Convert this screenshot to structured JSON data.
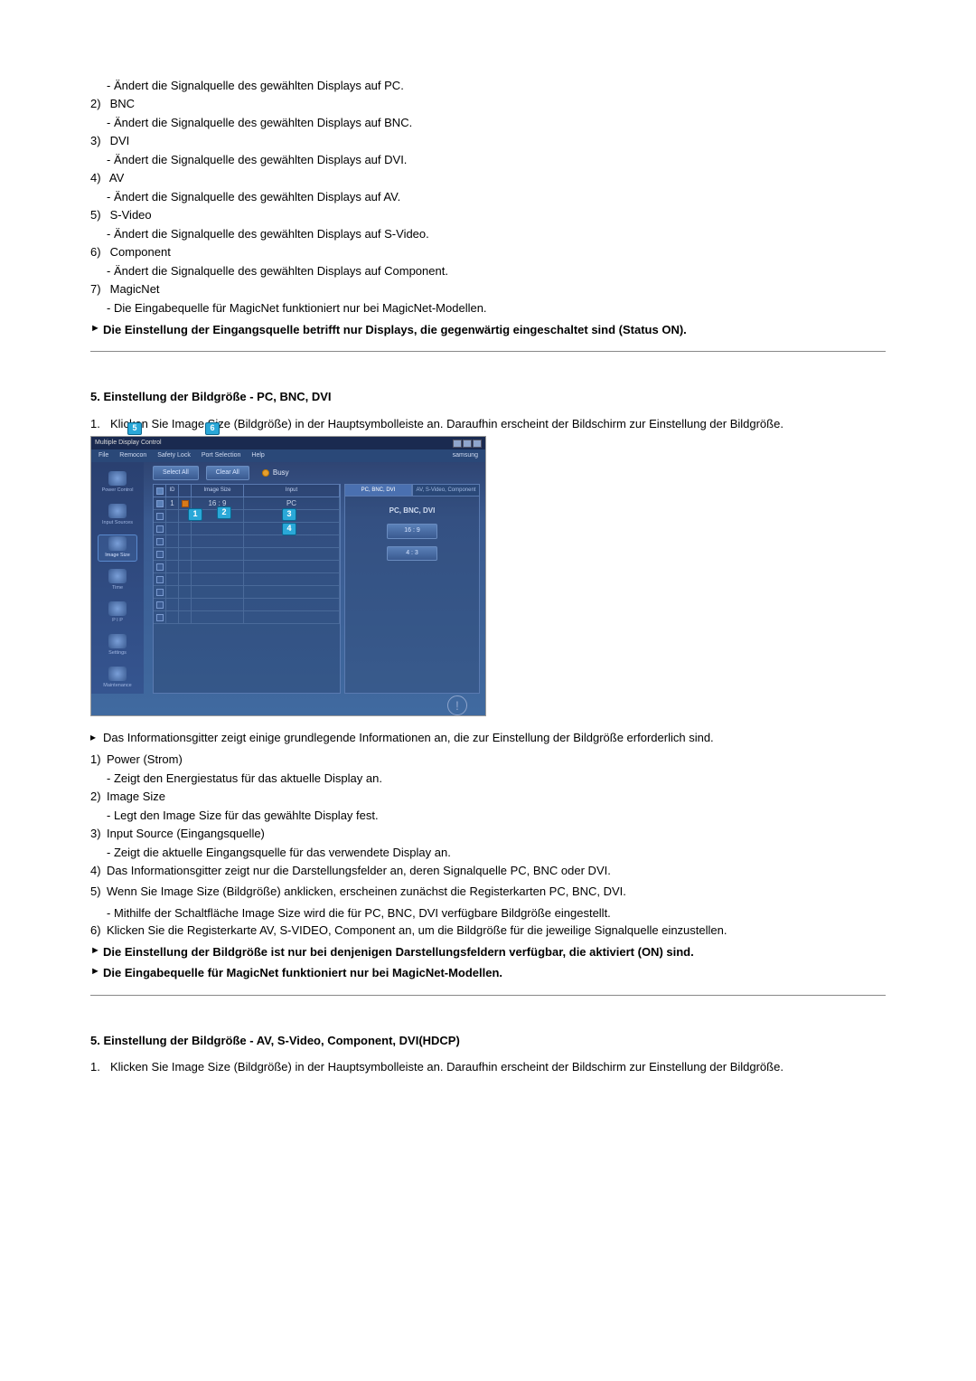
{
  "top_list": [
    {
      "sub": "- Ändert die Signalquelle des gewählten Displays auf PC."
    },
    {
      "num": "2)",
      "label": "BNC",
      "sub": "- Ändert die Signalquelle des gewählten Displays auf BNC."
    },
    {
      "num": "3)",
      "label": "DVI",
      "sub": "- Ändert die Signalquelle des gewählten Displays auf DVI."
    },
    {
      "num": "4)",
      "label": "AV",
      "sub": "- Ändert die Signalquelle des gewählten Displays auf AV."
    },
    {
      "num": "5)",
      "label": "S-Video",
      "sub": "- Ändert die Signalquelle des gewählten Displays auf S-Video."
    },
    {
      "num": "6)",
      "label": "Component",
      "sub": "- Ändert die Signalquelle des gewählten Displays auf Component."
    },
    {
      "num": "7)",
      "label": "MagicNet",
      "sub": "- Die Eingabequelle für MagicNet funktioniert nur bei MagicNet-Modellen."
    }
  ],
  "top_note": "Die Einstellung der Eingangsquelle betrifft nur Displays, die gegenwärtig eingeschaltet sind (Status ON).",
  "section5": {
    "title": "5. Einstellung der Bildgröße - PC, BNC, DVI",
    "intro_num": "1.",
    "intro": "Klicken Sie Image Size (Bildgröße) in der Hauptsymbolleiste an. Daraufhin erscheint der Bildschirm zur Einstellung der Bildgröße.",
    "info_note": "Das Informationsgitter zeigt einige grundlegende Informationen an, die zur Einstellung der Bildgröße erforderlich sind.",
    "items": [
      {
        "num": "1)",
        "label": "Power (Strom)",
        "sub": "- Zeigt den Energiestatus für das aktuelle Display an."
      },
      {
        "num": "2)",
        "label": "Image Size",
        "sub": "- Legt den Image Size für das gewählte Display fest."
      },
      {
        "num": "3)",
        "label": "Input Source (Eingangsquelle)",
        "sub": "- Zeigt die aktuelle Eingangsquelle für das verwendete Display an."
      },
      {
        "num": "4)",
        "label": "Das Informationsgitter zeigt nur die Darstellungsfelder an, deren Signalquelle PC, BNC oder DVI."
      },
      {
        "num": "5)",
        "label": "Wenn Sie Image Size (Bildgröße) anklicken, erscheinen zunächst die Registerkarten PC, BNC, DVI.",
        "sub": "- Mithilfe der Schaltfläche Image Size wird die für PC, BNC, DVI verfügbare Bildgröße eingestellt."
      },
      {
        "num": "6)",
        "label": "Klicken Sie die Registerkarte AV, S-VIDEO, Component an, um die Bildgröße für die jeweilige Signalquelle einzustellen."
      }
    ],
    "note1": "Die Einstellung der Bildgröße ist nur bei denjenigen Darstellungsfeldern verfügbar, die aktiviert (ON) sind.",
    "note2": "Die Eingabequelle für MagicNet funktioniert nur bei MagicNet-Modellen."
  },
  "section5b": {
    "title": "5. Einstellung der Bildgröße - AV, S-Video, Component, DVI(HDCP)",
    "intro_num": "1.",
    "intro": "Klicken Sie Image Size (Bildgröße) in der Hauptsymbolleiste an. Daraufhin erscheint der Bildschirm zur Einstellung der Bildgröße."
  },
  "screenshot": {
    "title": "Multiple Display Control",
    "menu": [
      "File",
      "Remocon",
      "Safety Lock",
      "Port Selection",
      "Help"
    ],
    "brand": "samsung",
    "sidebar": [
      "Power Control",
      "Input Sources",
      "Image Size",
      "Time",
      "P I P",
      "Settings",
      "Maintenance"
    ],
    "toolbar": {
      "select_all": "Select All",
      "clear_all": "Clear All",
      "busy": "Busy"
    },
    "grid_headers": [
      "",
      "ID",
      "",
      "Image Size",
      "Input"
    ],
    "grid_row": {
      "size": "16 : 9",
      "input": "PC"
    },
    "tabs": [
      "PC, BNC, DVI",
      "AV, S-Video, Component"
    ],
    "panel_label": "PC, BNC, DVI",
    "panel_btns": [
      "16 : 9",
      "4 : 3"
    ]
  }
}
